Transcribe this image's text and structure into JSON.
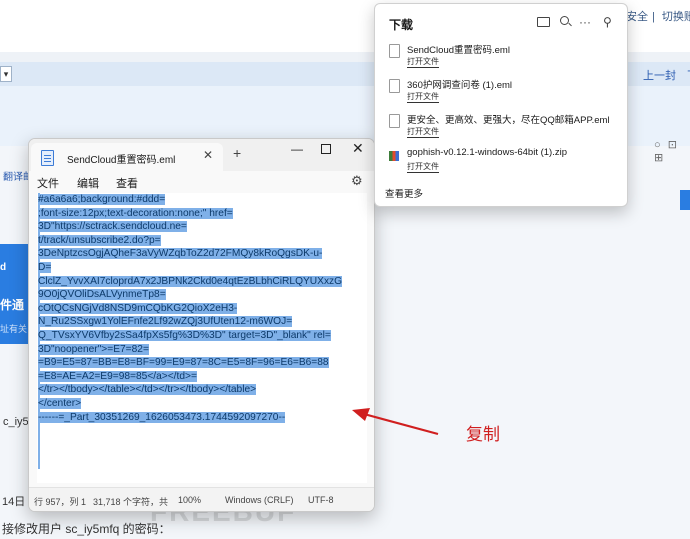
{
  "background": {
    "top_right_links": [
      "安全",
      "切换账号"
    ],
    "prev_next": [
      "上一封",
      "下一"
    ],
    "select_symbol": "▾",
    "translate": "翻译邮",
    "right_icons": "○ ⊡ ⊞",
    "banner": [
      "d",
      "件通",
      "址有关"
    ],
    "side_text_1": "c_iy5",
    "side_text_2": "14日",
    "bottom_text": "接修改用户 sc_iy5mfq 的密码：",
    "watermark": "FREEBUF"
  },
  "notepad": {
    "tab_title": "SendCloud重置密码.eml",
    "tab_close": "✕",
    "new_tab": "+",
    "minimize": "—",
    "close": "✕",
    "menu": [
      "文件",
      "编辑",
      "查看"
    ],
    "settings_icon": "⚙",
    "content_lines": [
      "#a6a6a6;background:#ddd=",
      ";font-size:12px;text-decoration:none;\" href=",
      "3D\"https://sctrack.sendcloud.ne=",
      "t/track/unsubscribe2.do?p=",
      "3DeNptzcsOgjAQheF3aVyWZqbToZ2d72FMQy8kRoQgsDK-u-",
      "D=",
      "ClclZ_YvvXAI7cloprdA7x2JBPNk2Ckd0e4qtEzBLbhCiRLQYUXxzG",
      "9O0jQVOliDsALVynmeTp8=",
      "cOtQCsNGjVd8NSD9mCQbKG2QioX2eH3-",
      "N_Ru2SSxgw1YolEFnfe2Lf92wZQj3UfUten12-m6WOJ=",
      "Q_TVsxYV6Vfby2sSa4fpXs5fg%3D%3D\" target=3D\"_blank\" rel=",
      "3D\"noopener\">=E7=82=",
      "=B9=E5=87=BB=E8=BF=99=E9=87=8C=E5=8F=96=E6=B6=88",
      "=E8=AE=A2=E9=98=85</a></td>=",
      "</tr></tbody></table></td></tr></tbody></table>",
      "</center>",
      "------=_Part_30351269_1626053473.1744592097270--"
    ],
    "status": {
      "position": "行 957，列 1",
      "chars": "31,718 个字符，共",
      "zoom": "100%",
      "line_ending": "Windows (CRLF)",
      "encoding": "UTF-8"
    }
  },
  "downloads": {
    "title": "下载",
    "pin_icon": "⚲",
    "more_icon": "···",
    "items": [
      {
        "name": "SendCloud重置密码.eml",
        "action": "打开文件"
      },
      {
        "name": "360护网调查问卷 (1).eml",
        "action": "打开文件"
      },
      {
        "name": "更安全、更高效、更强大，尽在QQ邮箱APP.eml",
        "action": "打开文件"
      },
      {
        "name": "gophish-v0.12.1-windows-64bit (1).zip",
        "action": "打开文件"
      }
    ],
    "view_more": "查看更多"
  },
  "annotation": {
    "label": "复制",
    "color": "#d01f1f"
  }
}
